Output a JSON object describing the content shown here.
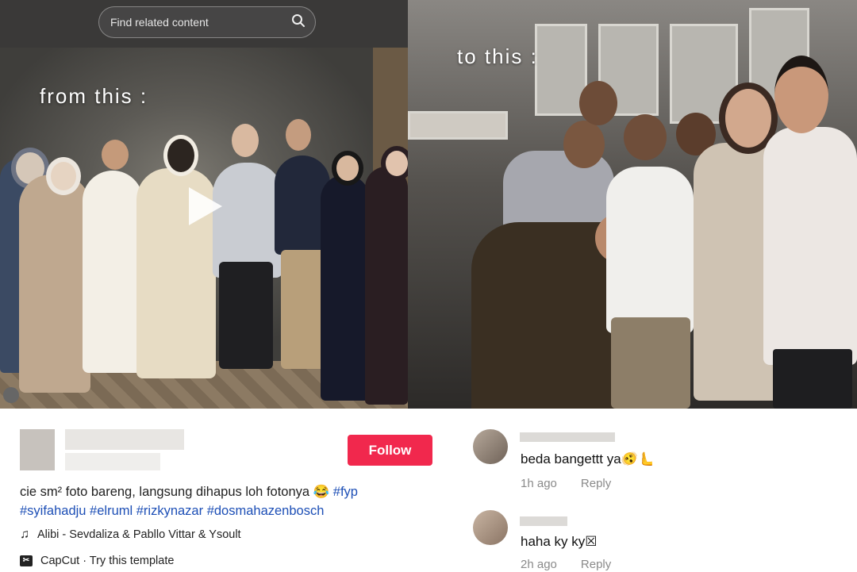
{
  "search": {
    "placeholder": "Find related content",
    "icon": "search-icon"
  },
  "video": {
    "left_caption": "from this :",
    "right_caption": "to this :",
    "play_icon": "play-icon"
  },
  "post": {
    "follow_label": "Follow",
    "description_text": "cie sm² foto bareng, langsung dihapus loh fotonya 😂",
    "hashtags_line1": "#fyp",
    "hashtags_line2": "#syifahadju #elruml #rizkynazar #dosmahazenbosch",
    "music": "Alibi - Sevdaliza & Pabllo Vittar & Ysoult",
    "template": "CapCut · Try this template",
    "accent": "#f1284d",
    "hashtag_color": "#1d4fb6"
  },
  "comments": [
    {
      "text": "beda bangettt ya🫨🫷",
      "time": "1h ago",
      "reply": "Reply"
    },
    {
      "text": "haha ky ky☒",
      "time": "2h ago",
      "reply": "Reply"
    }
  ]
}
